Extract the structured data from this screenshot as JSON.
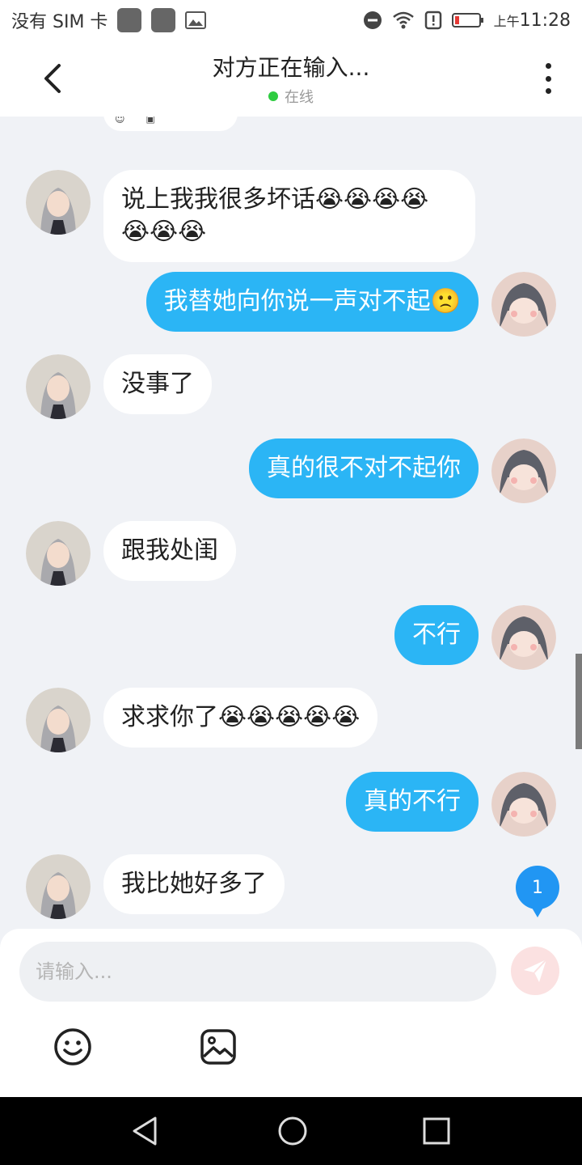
{
  "status_bar": {
    "carrier": "没有 SIM 卡",
    "time_prefix": "上午",
    "time": "11:28"
  },
  "header": {
    "title": "对方正在输入...",
    "status": "在线"
  },
  "messages": [
    {
      "side": "left",
      "text": "说上我我很多坏话😭😭😭😭",
      "text2": "😭😭😭"
    },
    {
      "side": "right",
      "text": "我替她向你说一声对不起🙁"
    },
    {
      "side": "left",
      "text": "没事了"
    },
    {
      "side": "right",
      "text": "真的很不对不起你"
    },
    {
      "side": "left",
      "text": "跟我处闺"
    },
    {
      "side": "right",
      "text": "不行"
    },
    {
      "side": "left",
      "text": "求求你了😭😭😭😭😭"
    },
    {
      "side": "right",
      "text": "真的不行"
    },
    {
      "side": "left",
      "text": "我比她好多了"
    }
  ],
  "unread_badge": "1",
  "input": {
    "placeholder": "请输入..."
  },
  "icons": {
    "back": "chevron-left-icon",
    "more": "more-vertical-icon",
    "send": "send-icon",
    "emoji": "emoji-icon",
    "image": "image-icon"
  },
  "colors": {
    "accent": "#2bb5f5",
    "online": "#2ecc40",
    "badge": "#2196f3"
  }
}
